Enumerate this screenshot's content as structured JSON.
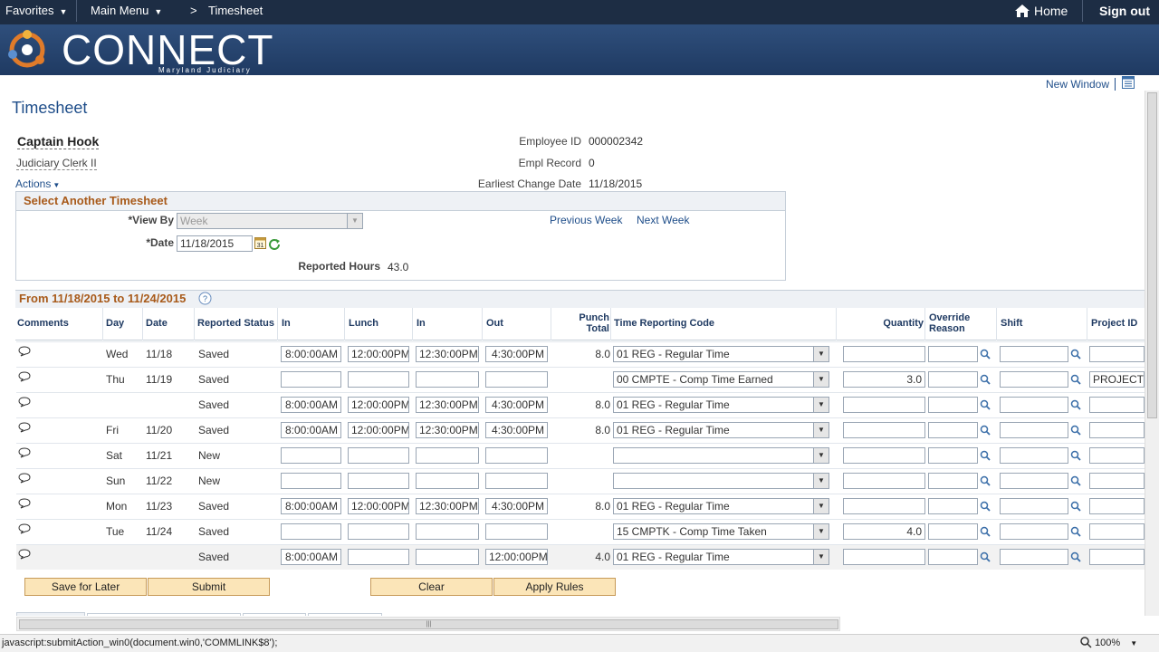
{
  "topnav": {
    "favorites": "Favorites",
    "main_menu": "Main Menu",
    "breadcrumb_sep": ">",
    "breadcrumb": "Timesheet",
    "home": "Home",
    "sign_out": "Sign out"
  },
  "banner": {
    "logo": "CONNECT",
    "logo_sub": "Maryland Judiciary"
  },
  "page": {
    "new_window": "New Window",
    "title": "Timesheet"
  },
  "employee": {
    "name": "Captain Hook",
    "job_title": "Judiciary Clerk II",
    "actions": "Actions",
    "employee_id_label": "Employee ID",
    "employee_id": "000002342",
    "empl_record_label": "Empl Record",
    "empl_record": "0",
    "earliest_change_label": "Earliest Change Date",
    "earliest_change": "11/18/2015"
  },
  "select_panel": {
    "header": "Select Another Timesheet",
    "view_by_label": "*View By",
    "view_by_value": "Week",
    "date_label": "*Date",
    "date_value": "11/18/2015",
    "previous_week": "Previous Week",
    "next_week": "Next Week",
    "reported_hours_label": "Reported Hours",
    "reported_hours": "43.0"
  },
  "grid": {
    "period": "From 11/18/2015 to 11/24/2015",
    "columns": {
      "comments": "Comments",
      "day": "Day",
      "date": "Date",
      "status": "Reported Status",
      "in1": "In",
      "lunch": "Lunch",
      "in2": "In",
      "out": "Out",
      "punch_total": "Punch Total",
      "trc": "Time Reporting Code",
      "quantity": "Quantity",
      "override": "Override Reason",
      "shift": "Shift",
      "project": "Project ID"
    },
    "rows": [
      {
        "day": "Wed",
        "date": "11/18",
        "status": "Saved",
        "in1": "8:00:00AM",
        "lunch": "12:00:00PM",
        "in2": "12:30:00PM",
        "out": "4:30:00PM",
        "total": "8.0",
        "trc": "01 REG - Regular Time",
        "qty": "",
        "project": ""
      },
      {
        "day": "Thu",
        "date": "11/19",
        "status": "Saved",
        "in1": "",
        "lunch": "",
        "in2": "",
        "out": "",
        "total": "",
        "trc": "00 CMPTE - Comp Time Earned",
        "qty": "3.0",
        "project": "PROJECTS"
      },
      {
        "day": "",
        "date": "",
        "status": "Saved",
        "in1": "8:00:00AM",
        "lunch": "12:00:00PM",
        "in2": "12:30:00PM",
        "out": "4:30:00PM",
        "total": "8.0",
        "trc": "01 REG - Regular Time",
        "qty": "",
        "project": ""
      },
      {
        "day": "Fri",
        "date": "11/20",
        "status": "Saved",
        "in1": "8:00:00AM",
        "lunch": "12:00:00PM",
        "in2": "12:30:00PM",
        "out": "4:30:00PM",
        "total": "8.0",
        "trc": "01 REG - Regular Time",
        "qty": "",
        "project": ""
      },
      {
        "day": "Sat",
        "date": "11/21",
        "status": "New",
        "in1": "",
        "lunch": "",
        "in2": "",
        "out": "",
        "total": "",
        "trc": "",
        "qty": "",
        "project": ""
      },
      {
        "day": "Sun",
        "date": "11/22",
        "status": "New",
        "in1": "",
        "lunch": "",
        "in2": "",
        "out": "",
        "total": "",
        "trc": "",
        "qty": "",
        "project": ""
      },
      {
        "day": "Mon",
        "date": "11/23",
        "status": "Saved",
        "in1": "8:00:00AM",
        "lunch": "12:00:00PM",
        "in2": "12:30:00PM",
        "out": "4:30:00PM",
        "total": "8.0",
        "trc": "01 REG - Regular Time",
        "qty": "",
        "project": ""
      },
      {
        "day": "Tue",
        "date": "11/24",
        "status": "Saved",
        "in1": "",
        "lunch": "",
        "in2": "",
        "out": "",
        "total": "",
        "trc": "15 CMPTK - Comp Time Taken",
        "qty": "4.0",
        "project": ""
      },
      {
        "day": "",
        "date": "",
        "status": "Saved",
        "in1": "8:00:00AM",
        "lunch": "",
        "in2": "",
        "out": "12:00:00PM",
        "total": "4.0",
        "trc": "01 REG - Regular Time",
        "qty": "",
        "project": ""
      }
    ]
  },
  "buttons": {
    "save_for_later": "Save for Later",
    "submit": "Submit",
    "clear": "Clear",
    "apply_rules": "Apply Rules"
  },
  "statusbar": {
    "url": "javascript:submitAction_win0(document.win0,'COMMLINK$8');",
    "zoom": "100%"
  },
  "colors": {
    "nav": "#1d2d44",
    "banner": "#2f4f7c",
    "header_orange": "#a85a1a",
    "button": "#fbe5b8"
  }
}
